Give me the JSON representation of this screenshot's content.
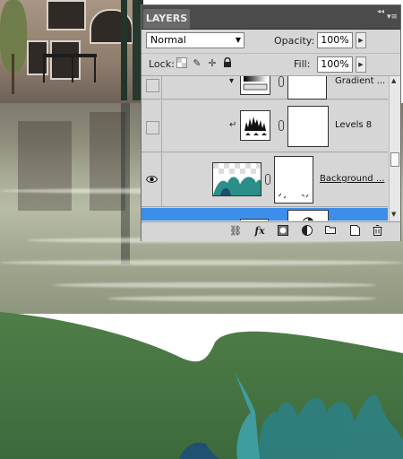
{
  "layers_panel": {
    "tab_label": "LAYERS",
    "blend_mode": "Normal",
    "opacity_label": "Opacity:",
    "opacity_value": "100%",
    "lock_label": "Lock:",
    "fill_label": "Fill:",
    "fill_value": "100%",
    "lock_icons": [
      "lock-transparent-icon",
      "lock-image-icon",
      "lock-position-icon",
      "lock-all-icon"
    ],
    "layers": [
      {
        "name": "Gradient ...",
        "visible": false,
        "thumb": "gradient-map-icon"
      },
      {
        "name": "Levels 8",
        "visible": false,
        "thumb": "levels-histogram-icon"
      },
      {
        "name": "Background ...",
        "visible": true,
        "thumb": "coral-image-thumb"
      },
      {
        "name": "",
        "visible": true,
        "thumb": "adjustment-icon",
        "selected": true
      }
    ],
    "footer_icons": [
      "link-layers-icon",
      "fx-icon",
      "add-mask-icon",
      "adjustment-layer-icon",
      "new-group-icon",
      "new-layer-icon",
      "delete-layer-icon"
    ],
    "fx_label": "fx",
    "selection_color": "#3d8ee9"
  }
}
